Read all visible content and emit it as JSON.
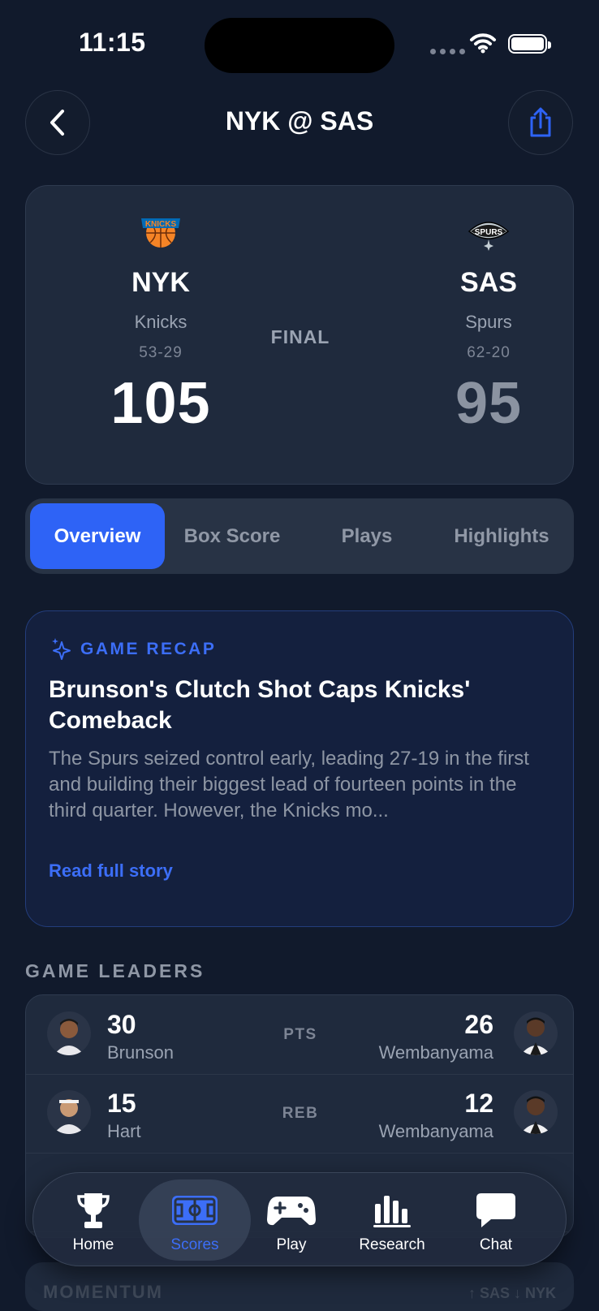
{
  "status_bar": {
    "time": "11:15"
  },
  "header": {
    "title": "NYK @ SAS"
  },
  "game": {
    "status": "FINAL",
    "away": {
      "abbr": "NYK",
      "name": "Knicks",
      "record": "53-29",
      "score": "105"
    },
    "home": {
      "abbr": "SAS",
      "name": "Spurs",
      "record": "62-20",
      "score": "95"
    }
  },
  "tabs": [
    "Overview",
    "Box Score",
    "Plays",
    "Highlights"
  ],
  "recap": {
    "kicker": "GAME RECAP",
    "headline": "Brunson's Clutch Shot Caps Knicks' Comeback",
    "body": "The Spurs seized control early, leading 27-19 in the first and building their biggest lead of fourteen points in the third quarter. However, the Knicks mo...",
    "link": "Read full story"
  },
  "leaders": {
    "title": "GAME LEADERS",
    "rows": [
      {
        "stat": "PTS",
        "away_value": "30",
        "away_player": "Brunson",
        "home_value": "26",
        "home_player": "Wembanyama"
      },
      {
        "stat": "REB",
        "away_value": "15",
        "away_player": "Hart",
        "home_value": "12",
        "home_player": "Wembanyama"
      }
    ]
  },
  "momentum": {
    "title": "MOMENTUM",
    "legend": "↑ SAS  ↓ NYK"
  },
  "tabbar": {
    "items": [
      {
        "label": "Home",
        "icon": "trophy-icon"
      },
      {
        "label": "Scores",
        "icon": "court-icon"
      },
      {
        "label": "Play",
        "icon": "gamepad-icon"
      },
      {
        "label": "Research",
        "icon": "bar-chart-icon"
      },
      {
        "label": "Chat",
        "icon": "chat-bubble-icon"
      }
    ],
    "active": "Scores"
  },
  "colors": {
    "accent": "#2e63f6",
    "background": "#111a2c",
    "card": "#1f2a3d",
    "knicks_orange": "#f58426",
    "knicks_blue": "#006bb6"
  }
}
